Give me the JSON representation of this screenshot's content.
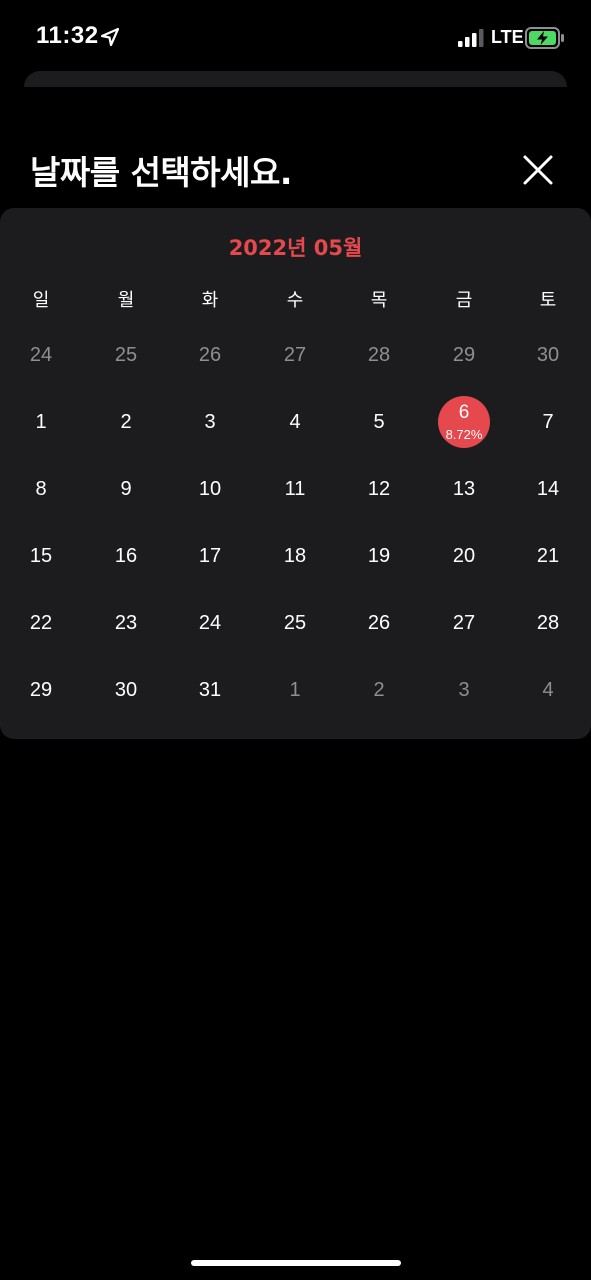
{
  "status_bar": {
    "time": "11:32",
    "network": "LTE",
    "icons": [
      "location-arrow-icon",
      "cellular-signal-icon",
      "battery-charging-icon"
    ]
  },
  "header": {
    "title": "날짜를 선택하세요.",
    "close_icon": "close-icon"
  },
  "calendar": {
    "month_label": "2022년 05월",
    "weekdays": [
      "일",
      "월",
      "화",
      "수",
      "목",
      "금",
      "토"
    ],
    "weeks": [
      [
        {
          "d": "24",
          "in": false
        },
        {
          "d": "25",
          "in": false
        },
        {
          "d": "26",
          "in": false
        },
        {
          "d": "27",
          "in": false
        },
        {
          "d": "28",
          "in": false
        },
        {
          "d": "29",
          "in": false
        },
        {
          "d": "30",
          "in": false
        }
      ],
      [
        {
          "d": "1",
          "in": true
        },
        {
          "d": "2",
          "in": true
        },
        {
          "d": "3",
          "in": true
        },
        {
          "d": "4",
          "in": true
        },
        {
          "d": "5",
          "in": true
        },
        {
          "d": "6",
          "in": true,
          "selected": true,
          "sub": "8.72%"
        },
        {
          "d": "7",
          "in": true
        }
      ],
      [
        {
          "d": "8",
          "in": true
        },
        {
          "d": "9",
          "in": true
        },
        {
          "d": "10",
          "in": true
        },
        {
          "d": "11",
          "in": true
        },
        {
          "d": "12",
          "in": true
        },
        {
          "d": "13",
          "in": true
        },
        {
          "d": "14",
          "in": true
        }
      ],
      [
        {
          "d": "15",
          "in": true
        },
        {
          "d": "16",
          "in": true
        },
        {
          "d": "17",
          "in": true
        },
        {
          "d": "18",
          "in": true
        },
        {
          "d": "19",
          "in": true
        },
        {
          "d": "20",
          "in": true
        },
        {
          "d": "21",
          "in": true
        }
      ],
      [
        {
          "d": "22",
          "in": true
        },
        {
          "d": "23",
          "in": true
        },
        {
          "d": "24",
          "in": true
        },
        {
          "d": "25",
          "in": true
        },
        {
          "d": "26",
          "in": true
        },
        {
          "d": "27",
          "in": true
        },
        {
          "d": "28",
          "in": true
        }
      ],
      [
        {
          "d": "29",
          "in": true
        },
        {
          "d": "30",
          "in": true
        },
        {
          "d": "31",
          "in": true
        },
        {
          "d": "1",
          "in": false
        },
        {
          "d": "2",
          "in": false
        },
        {
          "d": "3",
          "in": false
        },
        {
          "d": "4",
          "in": false
        }
      ]
    ]
  },
  "colors": {
    "accent": "#e5484d",
    "background": "#000000",
    "card": "#1c1c1e",
    "muted_text": "#8e8e93",
    "battery_fill": "#4cd964"
  }
}
